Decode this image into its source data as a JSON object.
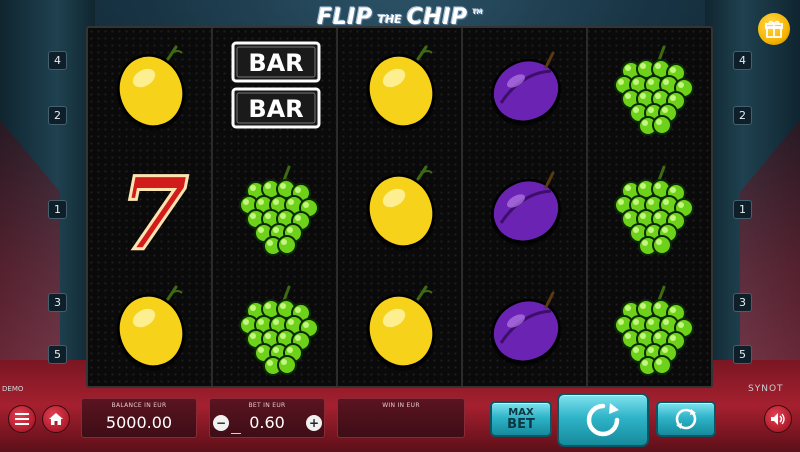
{
  "game": {
    "title_part1": "FLIP",
    "title_part2": "THE",
    "title_part3": "CHIP",
    "trademark": "TM",
    "mode": "DEMO",
    "brand": "SYNOT"
  },
  "paylines": {
    "left": [
      "4",
      "2",
      "1",
      "3",
      "5"
    ],
    "right": [
      "4",
      "2",
      "1",
      "3",
      "5"
    ]
  },
  "reels": [
    [
      "lemon",
      "seven",
      "lemon"
    ],
    [
      "bar-bar",
      "grapes",
      "grapes"
    ],
    [
      "lemon",
      "lemon",
      "lemon"
    ],
    [
      "plum",
      "plum",
      "plum"
    ],
    [
      "grapes",
      "grapes",
      "grapes"
    ]
  ],
  "symbol_text": {
    "bar": "BAR",
    "seven": "7"
  },
  "balance": {
    "label": "BALANCE IN EUR",
    "value": "5000.00"
  },
  "bet": {
    "label": "BET IN EUR",
    "value": "0.60",
    "minus": "−",
    "plus": "+"
  },
  "win": {
    "label": "WIN IN EUR",
    "value": ""
  },
  "buttons": {
    "max_bet_line1": "MAX",
    "max_bet_line2": "BET",
    "menu_icon": "hamburger-icon",
    "home_icon": "home-icon",
    "spin_icon": "spin-arrow-icon",
    "autoplay_icon": "autoplay-icon",
    "sound_icon": "speaker-icon",
    "gift_icon": "gift-icon"
  },
  "colors": {
    "reel_bg": "#0a0a0b",
    "panel": "#4a101a",
    "teal": "#2fb4c8",
    "lemon": "#f7d21b",
    "plum": "#6b23b3",
    "grapes": "#6fd21a",
    "seven": "#d21c1c"
  }
}
